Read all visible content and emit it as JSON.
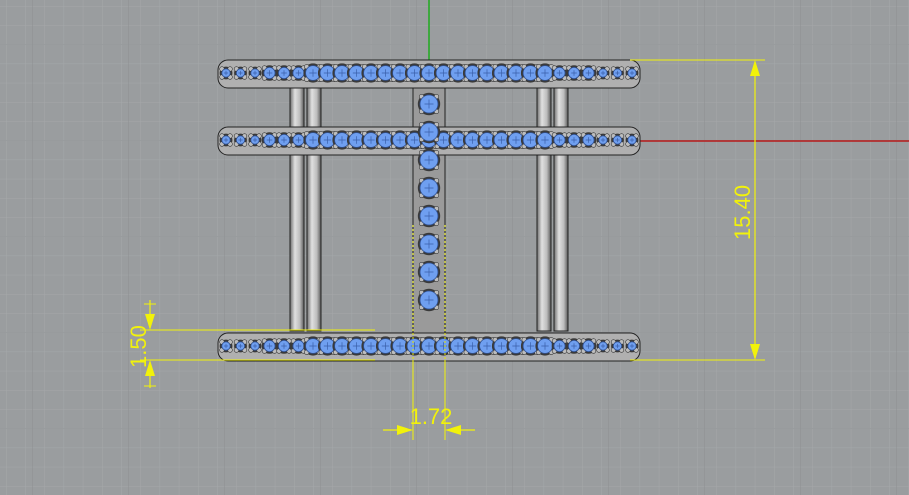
{
  "viewport": {
    "background": "#9a9d9f",
    "grid_minor_color": "#a3a6a8",
    "grid_major_color": "#8c8f91",
    "x_axis_color": "#b81a1a",
    "y_axis_color": "#1eaa1e"
  },
  "dimensions": {
    "overall_height": "15.40",
    "band_thickness": "1.50",
    "stone_row_width": "1.72",
    "color": "#f2f20a"
  },
  "model": {
    "stone_color": "#6f9ff0",
    "metal_color": "#c8c8c8",
    "outline_color": "#202020"
  }
}
